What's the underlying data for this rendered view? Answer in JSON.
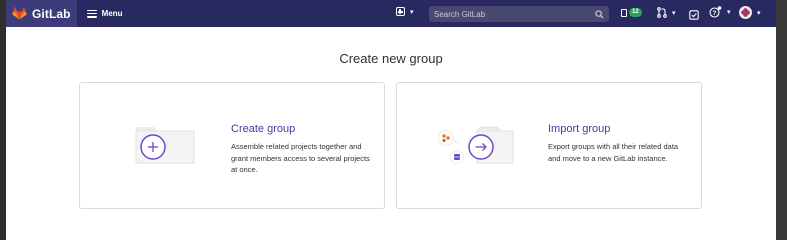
{
  "topbar": {
    "brand": "GitLab",
    "menu_label": "Menu",
    "search_placeholder": "Search GitLab",
    "issues_count": "12",
    "icons": [
      "gitlab-logo",
      "hamburger-icon",
      "plus-square-icon",
      "search-icon",
      "issues-icon",
      "merge-request-icon",
      "todo-icon",
      "help-icon",
      "avatar"
    ]
  },
  "page": {
    "title": "Create new group"
  },
  "cards": [
    {
      "title": "Create group",
      "description": "Assemble related projects together and grant members access to several projects at once."
    },
    {
      "title": "Import group",
      "description": "Export groups with all their related data and move to a new GitLab instance."
    }
  ],
  "colors": {
    "topbar": "#292961",
    "accent": "#6e49cb",
    "link": "#3f3fa0"
  }
}
